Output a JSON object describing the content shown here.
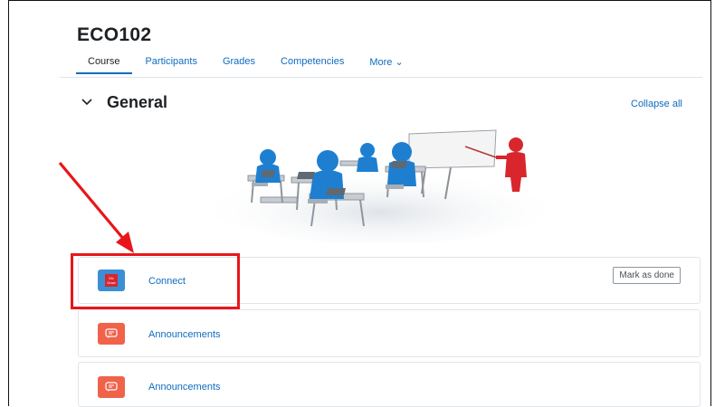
{
  "course": {
    "title": "ECO102"
  },
  "tabs": [
    {
      "label": "Course"
    },
    {
      "label": "Participants"
    },
    {
      "label": "Grades"
    },
    {
      "label": "Competencies"
    },
    {
      "label": "More ⌄"
    }
  ],
  "section": {
    "title": "General",
    "collapse_label": "Collapse all"
  },
  "activities": [
    {
      "label": "Connect",
      "icon": "mcgraw-hill-icon",
      "icon_color": "#3b8fd6",
      "mark_label": "Mark as done"
    },
    {
      "label": "Announcements",
      "icon": "forum-icon",
      "icon_color": "#f0624a"
    },
    {
      "label": "Announcements",
      "icon": "forum-icon",
      "icon_color": "#f0624a"
    }
  ],
  "colors": {
    "link": "#0f6cbf",
    "highlight": "#e8161b"
  }
}
